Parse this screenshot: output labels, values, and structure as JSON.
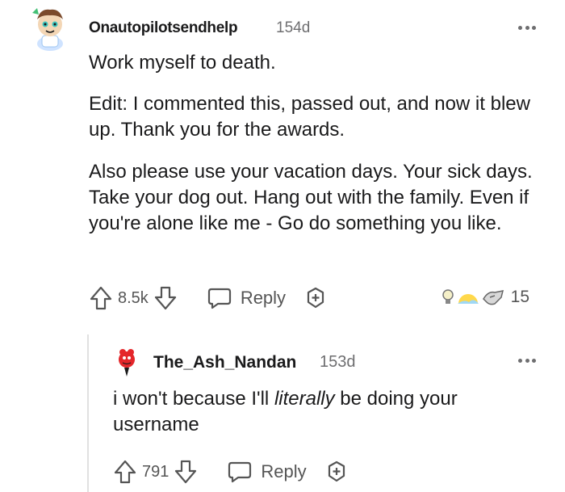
{
  "comment": {
    "username": "Onautopilotsendhelp",
    "age": "154d",
    "paragraphs": [
      "Work myself to death.",
      "Edit: I commented this, passed out, and now it blew up. Thank you for the awards.",
      "Also please use your vacation days. Your sick days. Take your dog out. Hang out with the family. Even if you're alone like me - Go do something you like."
    ],
    "score": "8.5k",
    "reply_label": "Reply",
    "award_count": "15",
    "icons": [
      "upvote-icon",
      "downvote-icon",
      "reply-bubble-icon",
      "give-award-icon",
      "more-options-icon"
    ]
  },
  "reply": {
    "username": "The_Ash_Nandan",
    "age": "153d",
    "text_before": "i won't because I'll ",
    "text_italic": "literally",
    "text_after": " be doing your username",
    "score": "791",
    "reply_label": "Reply"
  },
  "colors": {
    "text": "#1a1a1b",
    "meta": "#6e6e70",
    "action": "#555555",
    "thread_line": "#e1e1e1"
  }
}
